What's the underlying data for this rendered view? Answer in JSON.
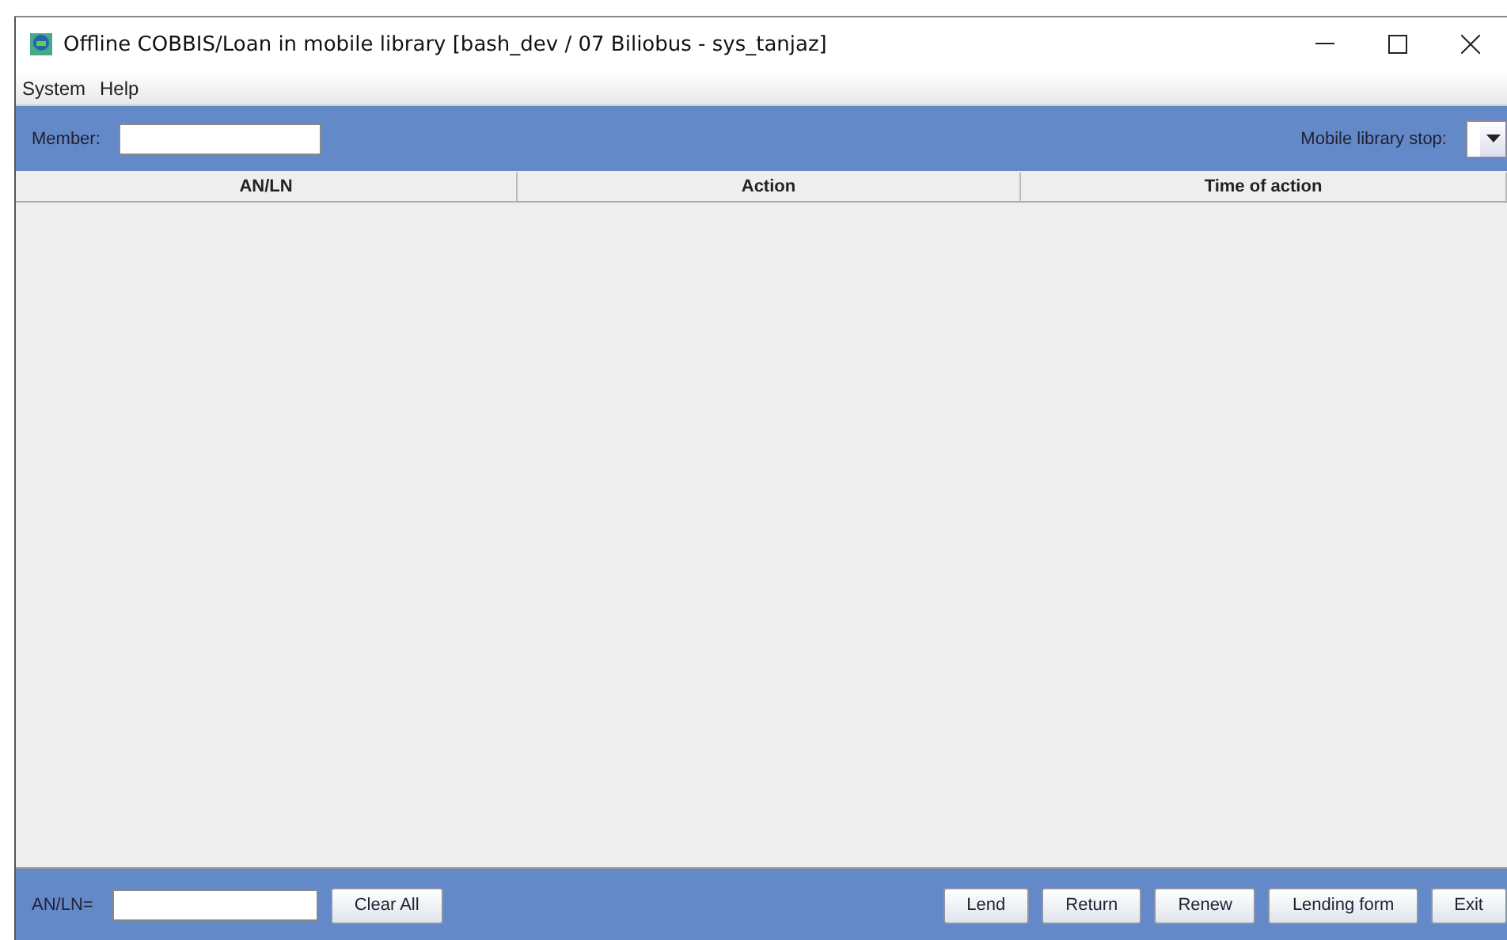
{
  "window": {
    "title": "Offline COBBIS/Loan in mobile library [bash_dev / 07 Biliobus - sys_tanjaz]"
  },
  "menu": [
    "System",
    "Help"
  ],
  "toolbar": {
    "member_label": "Member:",
    "stop_label": "Mobile library stop:"
  },
  "table": {
    "columns": [
      "AN/LN",
      "Action",
      "Time of action"
    ]
  },
  "footer": {
    "anln_label": "AN/LN=",
    "clear_button": "Clear All",
    "buttons": [
      "Lend",
      "Return",
      "Renew",
      "Lending form",
      "Exit"
    ]
  }
}
